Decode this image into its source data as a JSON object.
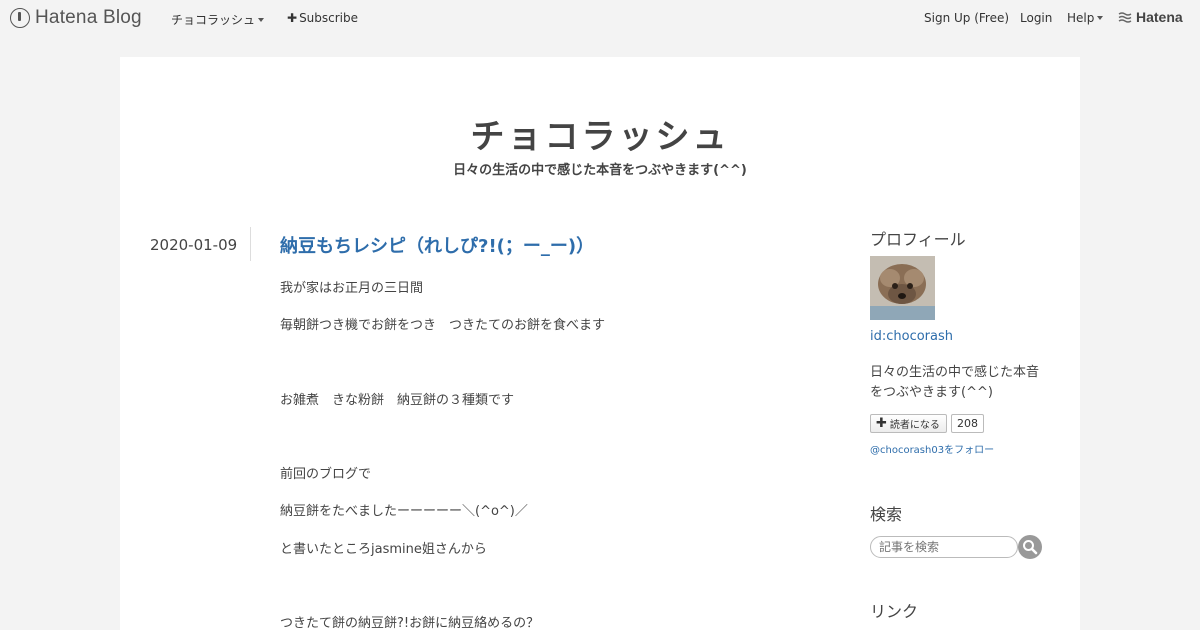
{
  "topbar": {
    "logo_text": "Hatena Blog",
    "blog_menu": "チョコラッシュ",
    "subscribe": "Subscribe",
    "signup": "Sign Up (Free)",
    "login": "Login",
    "help": "Help",
    "hatena": "Hatena"
  },
  "blog": {
    "title": "チョコラッシュ",
    "description": "日々の生活の中で感じた本音をつぶやきます(^^)"
  },
  "entry": {
    "date": "2020-01-09",
    "title": "納豆もちレシピ（れしぴ?!(；ー_ー)）",
    "paragraphs": [
      "我が家はお正月の三日間",
      "毎朝餅つき機でお餅をつき　つきたてのお餅を食べます",
      "お雑煮　きな粉餅　納豆餅の３種類です",
      "前回のブログで",
      "納豆餅をたべましたーーーーー＼(^o^)／",
      "と書いたところjasmine姐さんから",
      "つきたて餅の納豆餅?!お餅に納豆絡めるの？"
    ]
  },
  "sidebar": {
    "profile_heading": "プロフィール",
    "user_id": "id:chocorash",
    "profile_desc": "日々の生活の中で感じた本音をつぶやきます(^^)",
    "follow_label": "読者になる",
    "follow_count": "208",
    "twitter": "@chocorash03をフォロー",
    "search_heading": "検索",
    "search_placeholder": "記事を検索",
    "links_heading": "リンク"
  }
}
